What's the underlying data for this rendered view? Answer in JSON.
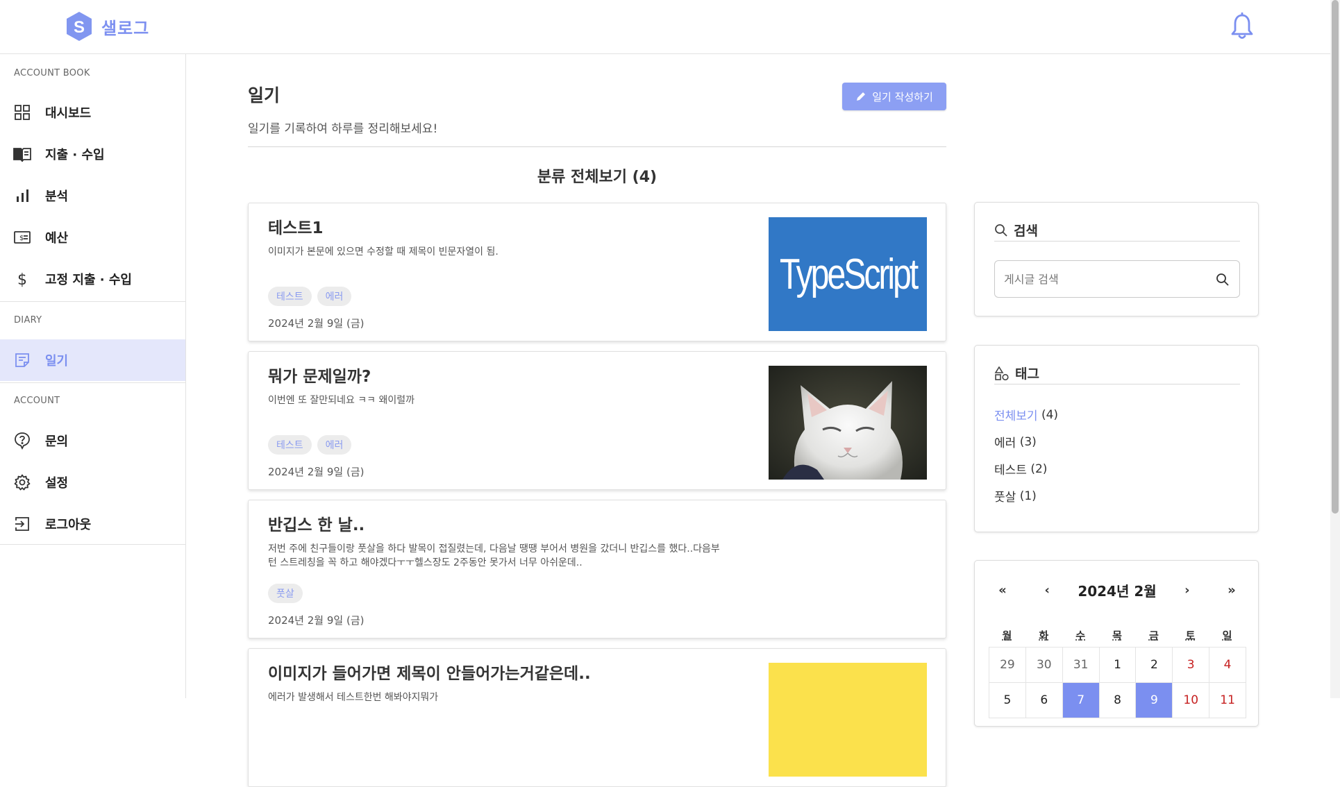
{
  "app": {
    "name": "샐로그",
    "logo_letter": "S",
    "accent": "#7b8ff0"
  },
  "sidebar": {
    "sections": [
      {
        "label": "ACCOUNT BOOK",
        "items": [
          {
            "label": "대시보드",
            "icon": "grid-icon"
          },
          {
            "label": "지출 · 수입",
            "icon": "book-icon"
          },
          {
            "label": "분석",
            "icon": "bar-chart-icon"
          },
          {
            "label": "예산",
            "icon": "money-icon"
          },
          {
            "label": "고정 지출 · 수입",
            "icon": "dollar-icon"
          }
        ]
      },
      {
        "label": "DIARY",
        "items": [
          {
            "label": "일기",
            "icon": "note-icon",
            "active": true
          }
        ]
      },
      {
        "label": "ACCOUNT",
        "items": [
          {
            "label": "문의",
            "icon": "question-icon"
          },
          {
            "label": "설정",
            "icon": "gear-icon"
          },
          {
            "label": "로그아웃",
            "icon": "logout-icon"
          }
        ]
      }
    ]
  },
  "main": {
    "title": "일기",
    "subtitle": "일기를 기록하여 하루를 정리해보세요!",
    "write_button": "일기 작성하기",
    "filter_title": "분류 전체보기 (4)",
    "posts": [
      {
        "title": "테스트1",
        "excerpt": "이미지가 본문에 있으면 수정할 때 제목이 빈문자열이 됨.",
        "tags": [
          "테스트",
          "에러"
        ],
        "date": "2024년 2월 9일 (금)",
        "thumb": "typescript-logo",
        "thumb_text": "TypeScript"
      },
      {
        "title": "뭐가 문제일까?",
        "excerpt": "이번엔 또 잘만되네요 ㅋㅋ 왜이럴까",
        "tags": [
          "테스트",
          "에러"
        ],
        "date": "2024년 2월 9일 (금)",
        "thumb": "cat-photo"
      },
      {
        "title": "반깁스 한 날..",
        "excerpt": "저번 주에 친구들이랑 풋살을 하다 발목이 접질렸는데, 다음날 땡땡 부어서 병원을 갔더니 반깁스를 했다..다음부턴 스트레칭을 꼭 하고 해야겠다ㅜㅜ헬스장도 2주동안 못가서 너무 아쉬운데..",
        "tags": [
          "풋살"
        ],
        "date": "2024년 2월 9일 (금)"
      },
      {
        "title": "이미지가 들어가면 제목이 안들어가는거같은데..",
        "excerpt": "에러가 발생해서 테스트한번 해봐야지뭐가",
        "thumb": "yellow-image"
      }
    ]
  },
  "search": {
    "title": "검색",
    "placeholder": "게시글 검색"
  },
  "tags_widget": {
    "title": "태그",
    "items": [
      {
        "name": "전체보기",
        "count": "(4)",
        "active": true
      },
      {
        "name": "에러",
        "count": "(3)"
      },
      {
        "name": "테스트",
        "count": "(2)"
      },
      {
        "name": "풋살",
        "count": "(1)"
      }
    ]
  },
  "calendar": {
    "title": "2024년 2월",
    "nav": {
      "first": "«",
      "prev": "‹",
      "next": "›",
      "last": "»"
    },
    "weekdays": [
      "월",
      "화",
      "수",
      "목",
      "금",
      "토",
      "일"
    ],
    "week1": [
      "29",
      "30",
      "31",
      "1",
      "2",
      "3",
      "4"
    ],
    "week2": [
      "5",
      "6",
      "7",
      "8",
      "9",
      "10",
      "11"
    ]
  }
}
